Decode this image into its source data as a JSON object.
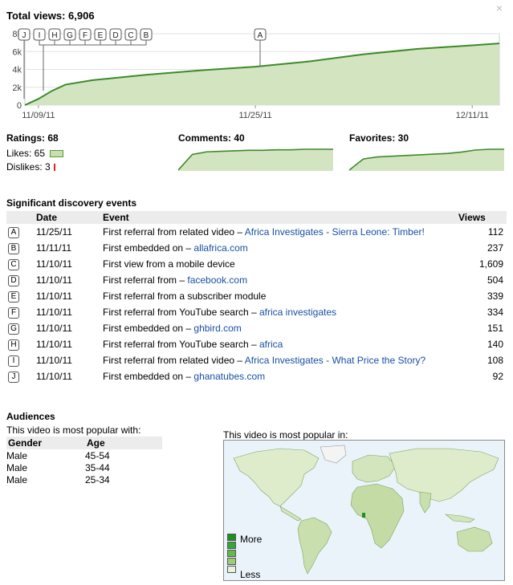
{
  "close_label": "×",
  "total_views_label": "Total views: 6,906",
  "main_chart_axis": {
    "y_ticks": [
      "8k",
      "6k",
      "4k",
      "2k",
      "0"
    ],
    "x_ticks": [
      "11/09/11",
      "11/25/11",
      "12/11/11"
    ]
  },
  "marker_letters": [
    "J",
    "I",
    "H",
    "G",
    "F",
    "E",
    "D",
    "C",
    "B",
    "A"
  ],
  "ratings": {
    "title": "Ratings: 68",
    "likes_label": "Likes: 65",
    "dislikes_label": "Dislikes: 3"
  },
  "comments_title": "Comments: 40",
  "favorites_title": "Favorites: 30",
  "discovery": {
    "title": "Significant discovery events",
    "headers": {
      "date": "Date",
      "event": "Event",
      "views": "Views"
    },
    "rows": [
      {
        "letter": "A",
        "date": "11/25/11",
        "event": "First referral from related video – ",
        "link": "Africa Investigates - Sierra Leone: Timber!",
        "views": "112"
      },
      {
        "letter": "B",
        "date": "11/11/11",
        "event": "First embedded on – ",
        "link": "allafrica.com",
        "views": "237"
      },
      {
        "letter": "C",
        "date": "11/10/11",
        "event": "First view from a mobile device",
        "link": "",
        "views": "1,609"
      },
      {
        "letter": "D",
        "date": "11/10/11",
        "event": "First referral from – ",
        "link": "facebook.com",
        "views": "504"
      },
      {
        "letter": "E",
        "date": "11/10/11",
        "event": "First referral from a subscriber module",
        "link": "",
        "views": "339"
      },
      {
        "letter": "F",
        "date": "11/10/11",
        "event": "First referral from YouTube search – ",
        "link": "africa investigates",
        "views": "334"
      },
      {
        "letter": "G",
        "date": "11/10/11",
        "event": "First embedded on – ",
        "link": "ghbird.com",
        "views": "151"
      },
      {
        "letter": "H",
        "date": "11/10/11",
        "event": "First referral from YouTube search – ",
        "link": "africa",
        "views": "140"
      },
      {
        "letter": "I",
        "date": "11/10/11",
        "event": "First referral from related video – ",
        "link": "Africa Investigates - What Price the Story?",
        "views": "108"
      },
      {
        "letter": "J",
        "date": "11/10/11",
        "event": "First embedded on – ",
        "link": "ghanatubes.com",
        "views": "92"
      }
    ]
  },
  "audiences": {
    "title": "Audiences",
    "subtitle": "This video is most popular with:",
    "headers": {
      "gender": "Gender",
      "age": "Age"
    },
    "rows": [
      {
        "gender": "Male",
        "age": "45-54"
      },
      {
        "gender": "Male",
        "age": "35-44"
      },
      {
        "gender": "Male",
        "age": "25-34"
      }
    ]
  },
  "map": {
    "title": "This video is most popular in:",
    "legend_more": "More",
    "legend_less": "Less",
    "legend_colors": [
      "#1f8f1f",
      "#3aa33a",
      "#66b84a",
      "#9ccc7a",
      "#e8f2dc"
    ]
  },
  "colors": {
    "area_fill": "#d3e5c0",
    "area_line": "#3c8a2a",
    "link": "#1a4fa5"
  },
  "chart_data": [
    {
      "type": "area",
      "title": "Total views: 6,906",
      "x": [
        "11/08/11",
        "11/09/11",
        "11/10/11",
        "11/11/11",
        "11/13/11",
        "11/17/11",
        "11/21/11",
        "11/25/11",
        "11/29/11",
        "12/03/11",
        "12/07/11",
        "12/11/11",
        "12/13/11"
      ],
      "values": [
        0,
        700,
        1600,
        2300,
        2800,
        3400,
        3900,
        4300,
        4900,
        5700,
        6300,
        6700,
        6906
      ],
      "ylim": [
        0,
        8000
      ],
      "y_ticks": [
        "8k",
        "6k",
        "4k",
        "2k",
        "0"
      ],
      "x_ticks": [
        "11/09/11",
        "11/25/11",
        "12/11/11"
      ],
      "grid": true
    },
    {
      "type": "area",
      "title": "Comments: 40",
      "values": [
        0,
        30,
        35,
        36,
        37,
        38,
        38,
        39,
        39,
        40,
        40,
        40
      ]
    },
    {
      "type": "area",
      "title": "Favorites: 30",
      "values": [
        0,
        16,
        19,
        20,
        21,
        22,
        23,
        24,
        26,
        29,
        30,
        30
      ]
    }
  ]
}
